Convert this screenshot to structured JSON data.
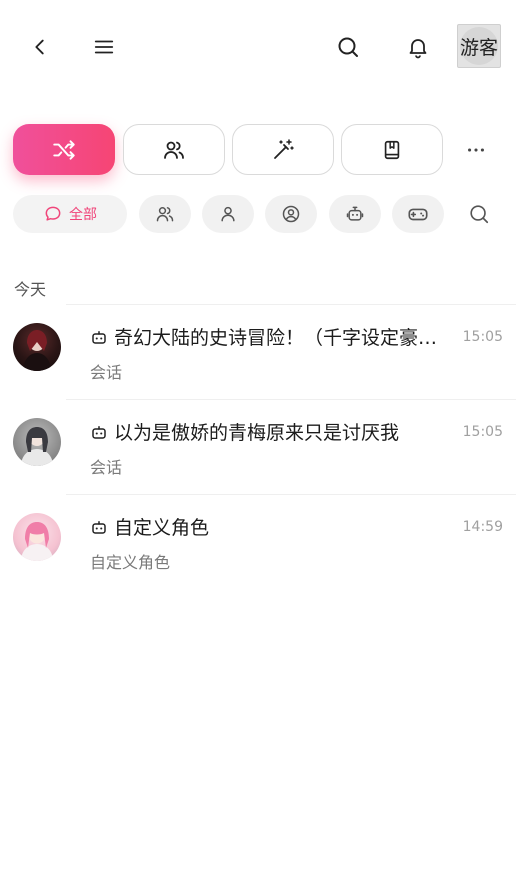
{
  "header": {
    "guest_label": "游客"
  },
  "icons": {
    "back": "back-icon",
    "menu": "menu-icon",
    "search": "search-icon",
    "bell": "bell-icon"
  },
  "modes": [
    {
      "icon": "shuffle-icon",
      "active": true
    },
    {
      "icon": "users-icon",
      "active": false
    },
    {
      "icon": "magic-wand-icon",
      "active": false
    },
    {
      "icon": "book-icon",
      "active": false
    }
  ],
  "filters": {
    "all_label": "全部"
  },
  "section": {
    "today": "今天"
  },
  "chats": [
    {
      "title": "奇幻大陆的史诗冒险！（千字设定豪…",
      "subtitle": "会话",
      "time": "15:05"
    },
    {
      "title": "以为是傲娇的青梅原来只是讨厌我",
      "subtitle": "会话",
      "time": "15:05"
    },
    {
      "title": "自定义角色",
      "subtitle": "自定义角色",
      "time": "14:59"
    }
  ],
  "colors": {
    "accent": "#f64574",
    "accent_gradient_start": "#f0509b"
  }
}
